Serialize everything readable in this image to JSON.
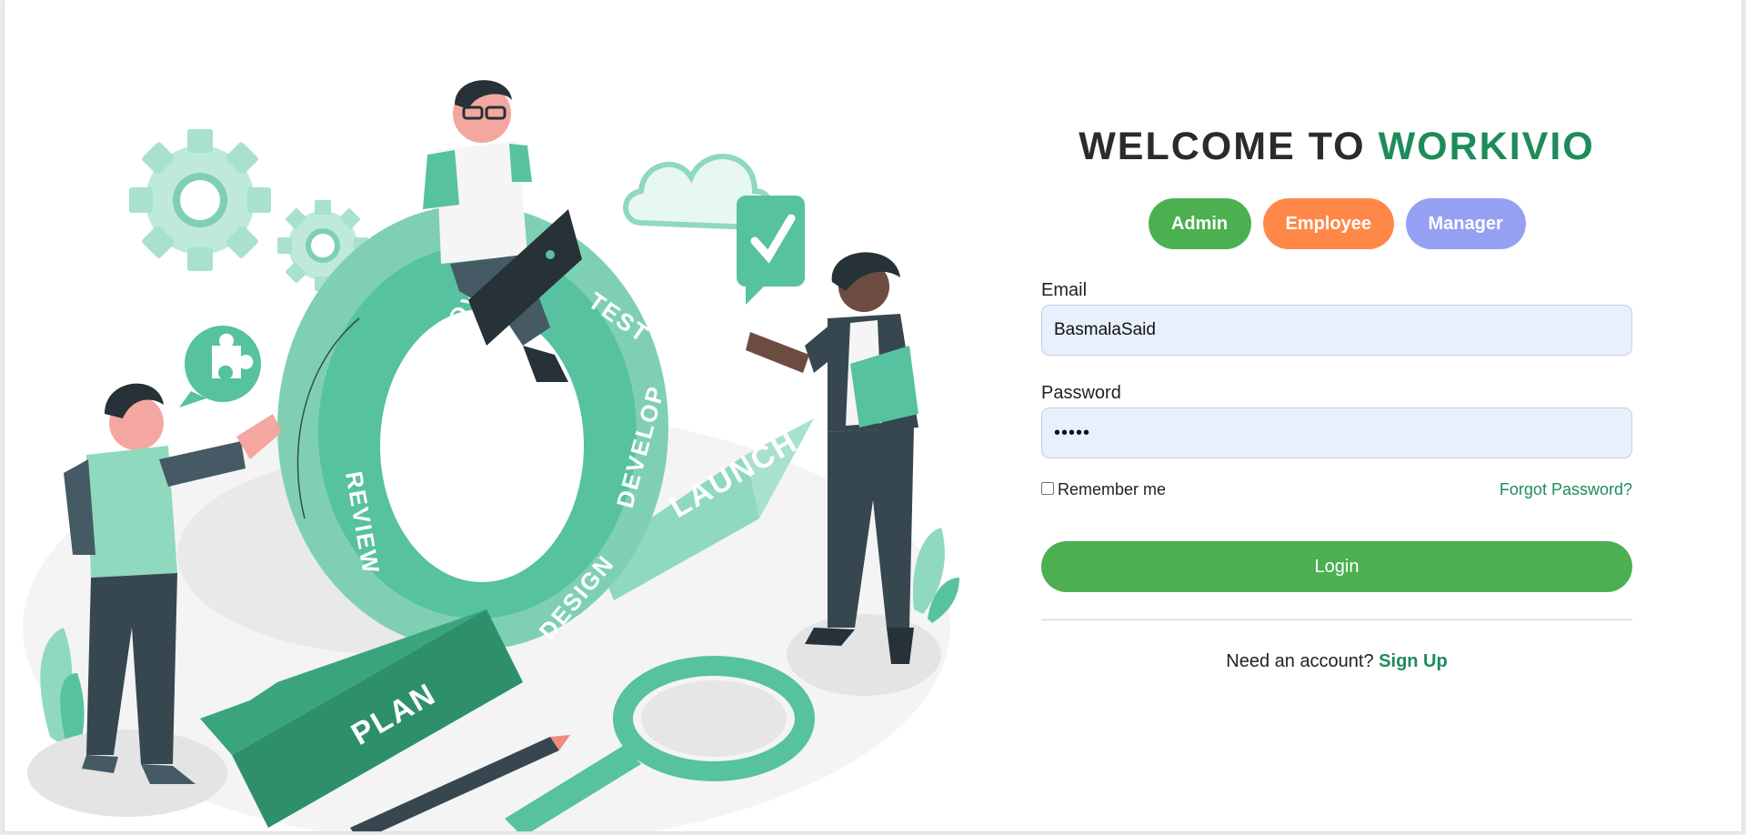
{
  "title": {
    "prefix": "WELCOME TO",
    "brand": "WORKIVIO"
  },
  "roles": [
    {
      "label": "Admin",
      "color": "#4caf50"
    },
    {
      "label": "Employee",
      "color": "#ff8848"
    },
    {
      "label": "Manager",
      "color": "#96a0f3"
    }
  ],
  "form": {
    "email_label": "Email",
    "email_value": "BasmalaSaid",
    "password_label": "Password",
    "password_value": "•••••",
    "remember_label": "Remember me",
    "remember_checked": false,
    "forgot_label": "Forgot Password?",
    "login_label": "Login"
  },
  "signup": {
    "prompt": "Need an account?",
    "link_label": "Sign Up"
  },
  "illustration": {
    "ring_labels": [
      "DEPLOY",
      "TEST",
      "DEVELOP",
      "DESIGN",
      "REVIEW"
    ],
    "arrow_labels": [
      "PLAN",
      "LAUNCH"
    ]
  },
  "colors": {
    "accent_green": "#1e8b5b",
    "button_green": "#4caf50",
    "input_bg": "#e8f0fe",
    "illustration_teal": "#56c29f"
  }
}
